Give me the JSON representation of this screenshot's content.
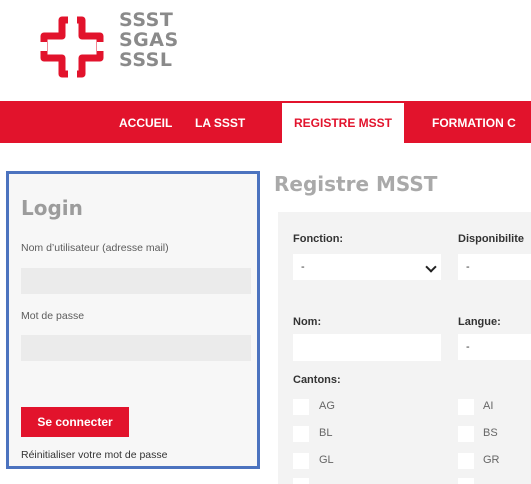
{
  "logo": {
    "lines": [
      "SSST",
      "SGAS",
      "SSSL"
    ],
    "icon": "swiss-cross-icon",
    "color_red": "#e2132c",
    "color_gray": "#8a8a8a"
  },
  "nav": {
    "items": [
      "ACCUEIL",
      "LA SSST",
      "REGISTRE MSST",
      "FORMATION C"
    ],
    "active": "REGISTRE MSST",
    "background": "#e2132c"
  },
  "login": {
    "title": "Login",
    "username_label": "Nom d’utilisateur (adresse mail)",
    "password_label": "Mot de passe",
    "submit_label": "Se connecter",
    "reset_link": "Réinitialiser votre mot de passe",
    "border_color": "#4c73bf"
  },
  "registre": {
    "title": "Registre MSST",
    "fonction_label": "Fonction:",
    "fonction_value": "-",
    "disponibilite_label": "Disponibilite",
    "disponibilite_value": "-",
    "nom_label": "Nom:",
    "langue_label": "Langue:",
    "langue_value": "-",
    "cantons_label": "Cantons:",
    "cantons_left": [
      "AG",
      "BL",
      "GL"
    ],
    "cantons_right": [
      "AI",
      "BS",
      "GR"
    ]
  }
}
